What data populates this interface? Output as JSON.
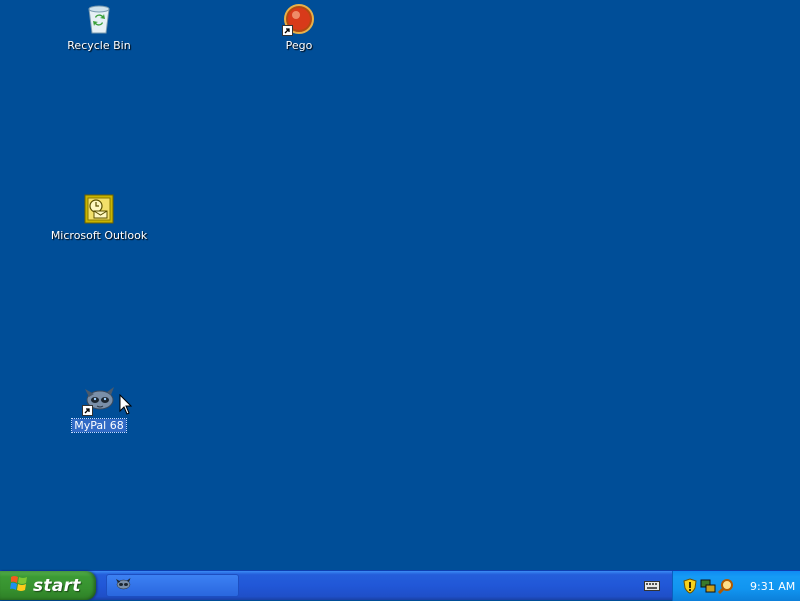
{
  "desktop": {
    "icons": [
      {
        "name": "recycle-bin",
        "label": "Recycle Bin",
        "shortcut": false,
        "selected": false
      },
      {
        "name": "pego",
        "label": "Pego",
        "shortcut": true,
        "selected": false
      },
      {
        "name": "microsoft-outlook",
        "label": "Microsoft Outlook",
        "shortcut": false,
        "selected": false
      },
      {
        "name": "mypal-68",
        "label": "MyPal 68",
        "shortcut": true,
        "selected": true
      }
    ]
  },
  "taskbar": {
    "start_label": "start",
    "task_buttons": [
      {
        "icon": "mypal-icon",
        "label": ""
      }
    ],
    "quick_launch": [
      {
        "icon": "keyboard-icon"
      }
    ],
    "tray": {
      "icons": [
        "security-shield-icon",
        "network-icon",
        "search-icon"
      ],
      "clock": "9:31 AM"
    }
  },
  "colors": {
    "desktop_background": "#004e98",
    "taskbar": "#245edb",
    "start_button": "#3c9a35",
    "tray": "#169bf5",
    "selection": "#316ac5"
  }
}
